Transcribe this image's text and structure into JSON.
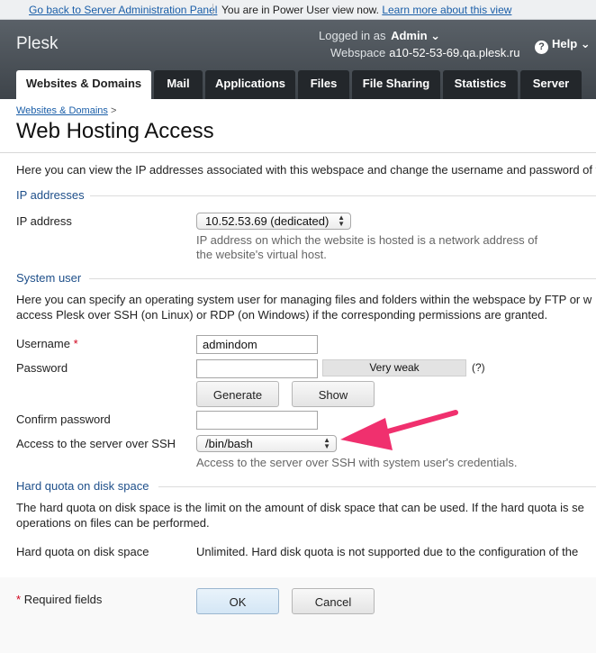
{
  "notice": {
    "back_link": "Go back to Server Administration Panel",
    "mode_text": "You are in Power User view now.",
    "learn_link": "Learn more about this view"
  },
  "header": {
    "logo": "Plesk",
    "logged_label": "Logged in as",
    "user": "Admin ⌄",
    "webspace_label": "Webspace",
    "webspace_value": "a10-52-53-69.qa.plesk.ru",
    "help": "Help ⌄"
  },
  "tabs": [
    {
      "label": "Websites & Domains"
    },
    {
      "label": "Mail"
    },
    {
      "label": "Applications"
    },
    {
      "label": "Files"
    },
    {
      "label": "File Sharing"
    },
    {
      "label": "Statistics"
    },
    {
      "label": "Server"
    }
  ],
  "breadcrumb": {
    "link": "Websites & Domains",
    "sep": ">"
  },
  "page_title": "Web Hosting Access",
  "intro": "Here you can view the IP addresses associated with this webspace and change the username and password of y",
  "ip_section": {
    "title": "IP addresses",
    "label": "IP address",
    "value": "10.52.53.69 (dedicated)",
    "hint1": "IP address on which the website is hosted is a network address of",
    "hint2": "the website's virtual host."
  },
  "system_user": {
    "title": "System user",
    "desc1": "Here you can specify an operating system user for managing files and folders within the webspace by FTP or w",
    "desc2": "access Plesk over SSH (on Linux) or RDP (on Windows) if the corresponding permissions are granted.",
    "username_label": "Username",
    "required_mark": "*",
    "username_value": "admindom",
    "password_label": "Password",
    "password_value": "",
    "strength": "Very weak",
    "strength_help": "(?)",
    "generate_label": "Generate",
    "show_label": "Show",
    "confirm_label": "Confirm password",
    "confirm_value": "",
    "ssh_label": "Access to the server over SSH",
    "ssh_value": "/bin/bash",
    "ssh_hint": "Access to the server over SSH with system user's credentials."
  },
  "quota": {
    "title": "Hard quota on disk space",
    "desc1": "The hard quota on disk space is the limit on the amount of disk space that can be used. If the hard quota is se",
    "desc2": "operations on files can be performed.",
    "label": "Hard quota on disk space",
    "value": "Unlimited. Hard disk quota is not supported due to the configuration of the"
  },
  "footer": {
    "required_mark": "*",
    "required_text": "Required fields",
    "ok_label": "OK",
    "cancel_label": "Cancel"
  },
  "annotation": {
    "arrow_color": "#f0306e"
  }
}
